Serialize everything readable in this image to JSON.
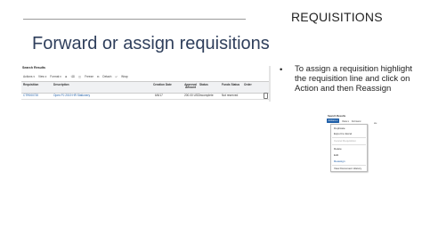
{
  "slide": {
    "corner_title": "REQUISITIONS",
    "title": "Forward or assign requisitions",
    "bullet_char": "•",
    "bullet_text": "To assign a requisition highlight the requisition line and click on Action  and then Reassign"
  },
  "search_results": {
    "title": "Search Results",
    "toolbar": [
      "Actions ▾",
      "View ▾",
      "Format ▾",
      "⊕",
      "⌫",
      "◫",
      "Freeze",
      "⧉",
      "Detach",
      "↵",
      "Wrap"
    ],
    "columns": [
      "Requisition",
      "Description",
      "Creation Date",
      "Approval Amount",
      "Status",
      "Funds Status",
      "Order"
    ],
    "rows": [
      {
        "requisition": "CTR000720",
        "description": "Open PJ 2019 HR Stationery",
        "creation_date": "6/6/17",
        "approval_amount": "200.00 USD",
        "status": "Incomplete",
        "funds_status": "Not reserved",
        "order": ""
      }
    ]
  },
  "action_menu": {
    "title": "Search Results",
    "actions_label": "Actions ▾",
    "view_label": "View ▾",
    "format_label": "Format ▾",
    "hint": "ate",
    "items": [
      {
        "label": "Duplicate",
        "state": "enabled"
      },
      {
        "label": "Export to Excel",
        "state": "enabled"
      },
      {
        "label": "Cancel Requisition",
        "state": "disabled"
      },
      {
        "label": "Delete",
        "state": "enabled"
      },
      {
        "label": "Edit",
        "state": "enabled"
      },
      {
        "label": "Reassign",
        "state": "highlighted"
      },
      {
        "label": "View Document History",
        "state": "enabled"
      }
    ]
  }
}
